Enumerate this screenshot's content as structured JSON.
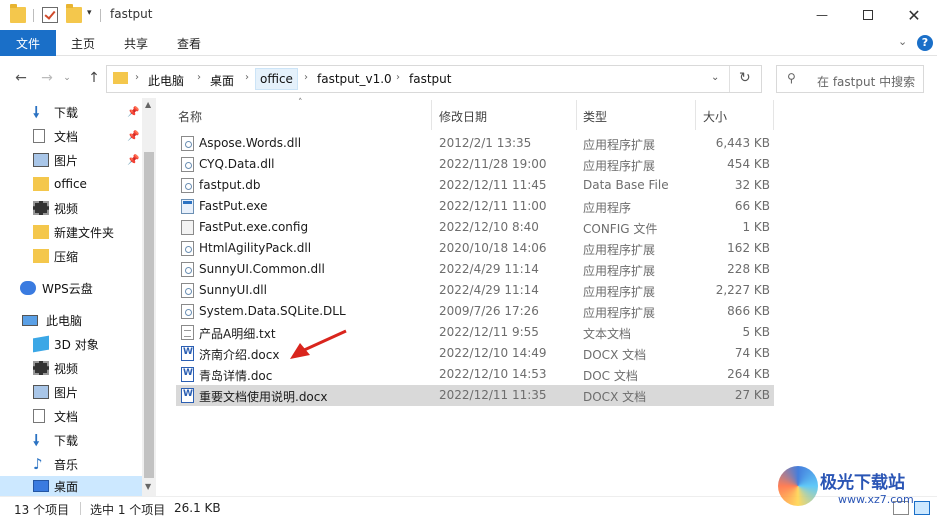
{
  "window": {
    "title": "fastput"
  },
  "ribbon": {
    "tabs": [
      "文件",
      "主页",
      "共享",
      "查看"
    ]
  },
  "address": {
    "crumbs": [
      "此电脑",
      "桌面",
      "office",
      "fastput_v1.0",
      "fastput"
    ],
    "search_placeholder": "在 fastput 中搜索"
  },
  "nav": {
    "items": [
      {
        "label": "下载",
        "icon": "download-arrow-icon",
        "pinned": true
      },
      {
        "label": "文档",
        "icon": "document-icon",
        "pinned": true
      },
      {
        "label": "图片",
        "icon": "picture-icon",
        "pinned": true
      },
      {
        "label": "office",
        "icon": "folder-icon",
        "pinned": false
      },
      {
        "label": "视频",
        "icon": "film-icon",
        "pinned": false
      },
      {
        "label": "新建文件夹",
        "icon": "folder-icon",
        "pinned": false
      },
      {
        "label": "压缩",
        "icon": "folder-icon",
        "pinned": false
      },
      {
        "label": "WPS云盘",
        "icon": "cloud-icon",
        "pinned": false
      },
      {
        "label": "此电脑",
        "icon": "computer-icon",
        "pinned": false
      },
      {
        "label": "3D 对象",
        "icon": "cube-icon",
        "pinned": false
      },
      {
        "label": "视频",
        "icon": "film-icon",
        "pinned": false
      },
      {
        "label": "图片",
        "icon": "picture-icon",
        "pinned": false
      },
      {
        "label": "文档",
        "icon": "document-icon",
        "pinned": false
      },
      {
        "label": "下载",
        "icon": "download-arrow-icon",
        "pinned": false
      },
      {
        "label": "音乐",
        "icon": "music-note-icon",
        "pinned": false
      },
      {
        "label": "桌面",
        "icon": "desktop-icon",
        "pinned": false
      }
    ]
  },
  "columns": {
    "name": "名称",
    "date": "修改日期",
    "type": "类型",
    "size": "大小"
  },
  "files": [
    {
      "name": "Aspose.Words.dll",
      "date": "2012/2/1 13:35",
      "type": "应用程序扩展",
      "size": "6,443 KB",
      "icon": "dll"
    },
    {
      "name": "CYQ.Data.dll",
      "date": "2022/11/28 19:00",
      "type": "应用程序扩展",
      "size": "454 KB",
      "icon": "dll"
    },
    {
      "name": "fastput.db",
      "date": "2022/12/11 11:45",
      "type": "Data Base File",
      "size": "32 KB",
      "icon": "dll"
    },
    {
      "name": "FastPut.exe",
      "date": "2022/12/11 11:00",
      "type": "应用程序",
      "size": "66 KB",
      "icon": "exe"
    },
    {
      "name": "FastPut.exe.config",
      "date": "2022/12/10 8:40",
      "type": "CONFIG 文件",
      "size": "1 KB",
      "icon": "cfg"
    },
    {
      "name": "HtmlAgilityPack.dll",
      "date": "2020/10/18 14:06",
      "type": "应用程序扩展",
      "size": "162 KB",
      "icon": "dll"
    },
    {
      "name": "SunnyUI.Common.dll",
      "date": "2022/4/29 11:14",
      "type": "应用程序扩展",
      "size": "228 KB",
      "icon": "dll"
    },
    {
      "name": "SunnyUI.dll",
      "date": "2022/4/29 11:14",
      "type": "应用程序扩展",
      "size": "2,227 KB",
      "icon": "dll"
    },
    {
      "name": "System.Data.SQLite.DLL",
      "date": "2009/7/26 17:26",
      "type": "应用程序扩展",
      "size": "866 KB",
      "icon": "dll"
    },
    {
      "name": "产品A明细.txt",
      "date": "2022/12/11 9:55",
      "type": "文本文档",
      "size": "5 KB",
      "icon": "txt"
    },
    {
      "name": "济南介绍.docx",
      "date": "2022/12/10 14:49",
      "type": "DOCX 文档",
      "size": "74 KB",
      "icon": "doc"
    },
    {
      "name": "青岛详情.doc",
      "date": "2022/12/10 14:53",
      "type": "DOC 文档",
      "size": "264 KB",
      "icon": "doc"
    },
    {
      "name": "重要文档使用说明.docx",
      "date": "2022/12/11 11:35",
      "type": "DOCX 文档",
      "size": "27 KB",
      "icon": "doc"
    }
  ],
  "selected_index": 12,
  "status": {
    "count": "13 个项目",
    "selected": "选中 1 个项目",
    "size": "26.1 KB"
  },
  "watermark": {
    "text": "极光下载站",
    "url": "www.xz7.com"
  },
  "colors": {
    "accent": "#1a6fc8",
    "selection": "#d9d9d9",
    "arrow": "#d9251d"
  }
}
